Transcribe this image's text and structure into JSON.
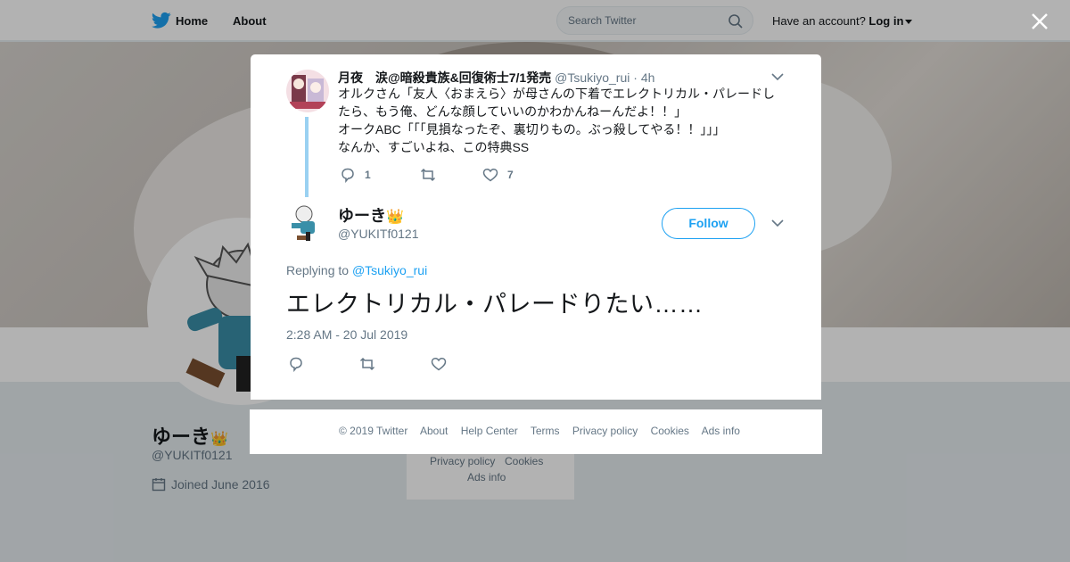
{
  "header": {
    "nav_home": "Home",
    "nav_about": "About",
    "search_placeholder": "Search Twitter",
    "account_prompt": "Have an account?",
    "login_label": "Log in"
  },
  "profile": {
    "name": "ゆーき",
    "crown": "👑",
    "handle": "@YUKITf0121",
    "joined": "Joined June 2016"
  },
  "background_footer": {
    "privacy": "Privacy policy",
    "cookies": "Cookies",
    "ads": "Ads info"
  },
  "parent_tweet": {
    "name": "月夜　涙@暗殺貴族&回復術士7/1発売",
    "handle": "@Tsukiyo_rui",
    "time": "· 4h",
    "lines": [
      "オルクさん「友人〈おまえら〉が母さんの下着でエレクトリカル・パレードし",
      "たら、もう俺、どんな顔していいのかわかんねーんだよ！！」",
      "オークABC「「「見損なったぞ、裏切りもの。ぶっ殺してやる！！」」」",
      "なんか、すごいよね、この特典SS"
    ],
    "reply_count": "1",
    "retweet_count": "",
    "like_count": "7"
  },
  "main_tweet": {
    "name": "ゆーき",
    "crown": "👑",
    "handle": "@YUKITf0121",
    "follow_label": "Follow",
    "replying_prefix": "Replying to",
    "replying_to": "@Tsukiyo_rui",
    "text": "エレクトリカル・パレードりたい……",
    "timestamp": "2:28 AM - 20 Jul 2019"
  },
  "modal_footer": {
    "links": [
      "© 2019 Twitter",
      "About",
      "Help Center",
      "Terms",
      "Privacy policy",
      "Cookies",
      "Ads info"
    ]
  },
  "colors": {
    "accent": "#1da1f2",
    "muted": "#657786",
    "thread_line": "#9ad1f2"
  },
  "icons": [
    "twitter-bird-icon",
    "search-icon",
    "caret-down-icon",
    "close-icon",
    "reply-icon",
    "retweet-icon",
    "like-icon",
    "calendar-icon",
    "chevron-down-icon"
  ]
}
